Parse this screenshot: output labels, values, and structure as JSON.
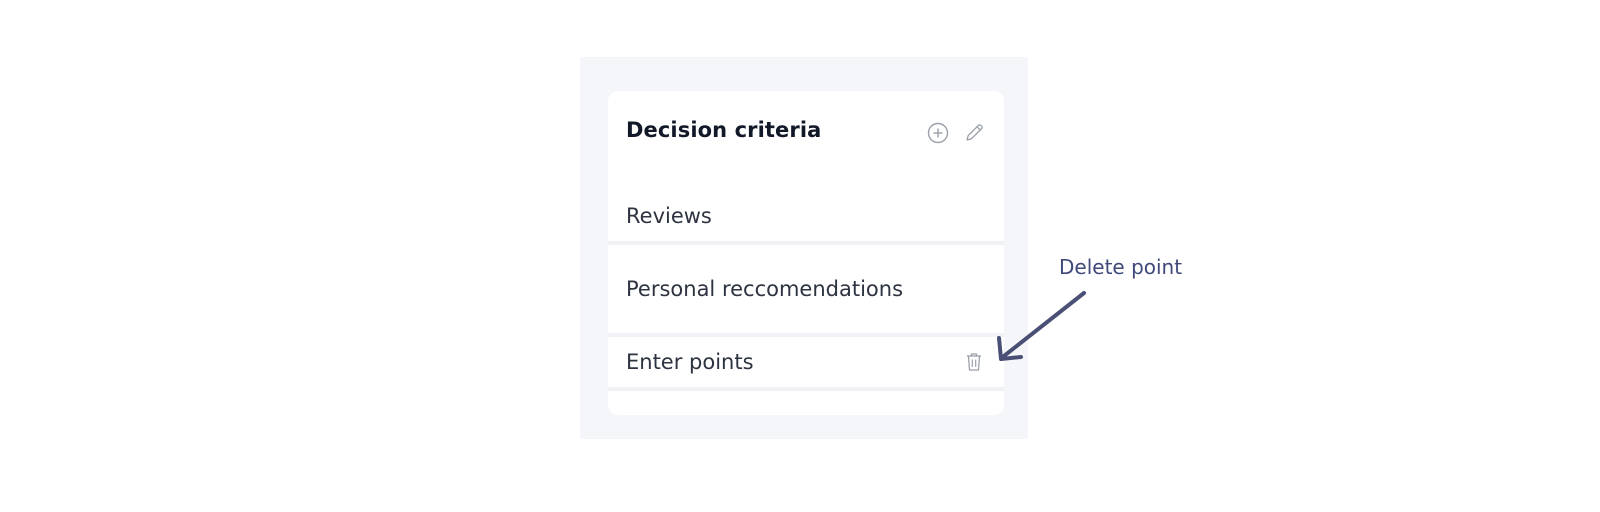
{
  "card": {
    "title": "Decision criteria",
    "header_icons": [
      "plus-circle-icon",
      "pencil-icon"
    ],
    "items": [
      {
        "label": "Reviews"
      },
      {
        "label": "Personal reccomendations"
      },
      {
        "label": "Enter points",
        "trailing_icon": "trash-icon"
      }
    ]
  },
  "annotation": {
    "label": "Delete point",
    "color": "#3f4a7a"
  },
  "colors": {
    "panel_background": "#f5f6fa",
    "card_background": "#ffffff",
    "divider": "#f1f2f6",
    "icon_gray": "#9aa0a8"
  }
}
